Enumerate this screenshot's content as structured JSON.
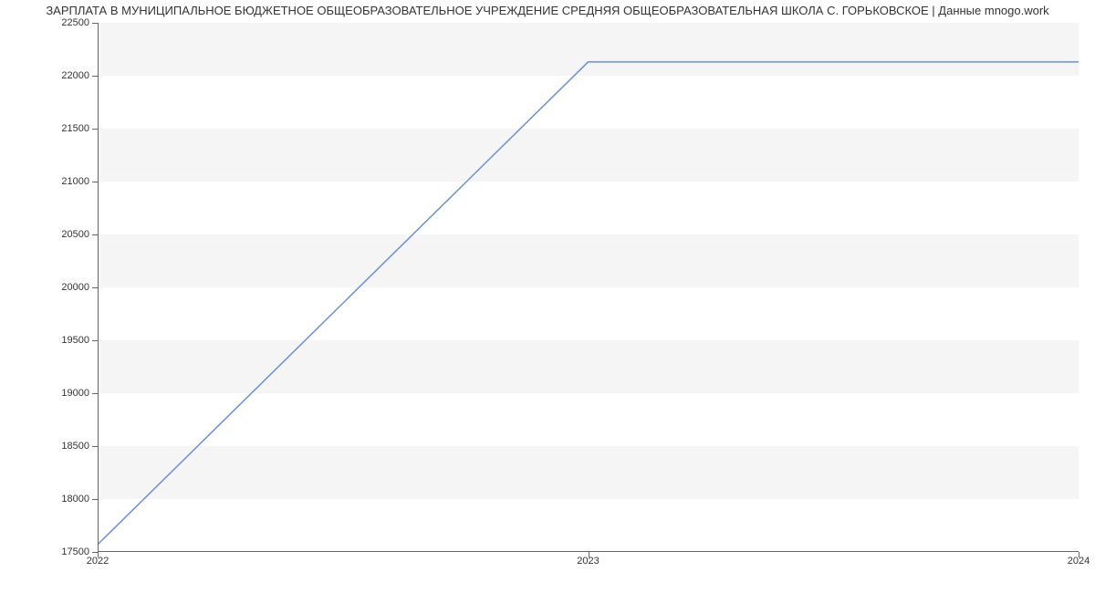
{
  "chart_data": {
    "type": "line",
    "title": "ЗАРПЛАТА В МУНИЦИПАЛЬНОЕ БЮДЖЕТНОЕ ОБЩЕОБРАЗОВАТЕЛЬНОЕ УЧРЕЖДЕНИЕ СРЕДНЯЯ ОБЩЕОБРАЗОВАТЕЛЬНАЯ ШКОЛА С. ГОРЬКОВСКОЕ | Данные mnogo.work",
    "xlabel": "",
    "ylabel": "",
    "ylim": [
      17500,
      22500
    ],
    "xlim": [
      2022,
      2024
    ],
    "x_ticks": [
      "2022",
      "2023",
      "2024"
    ],
    "y_ticks": [
      17500,
      18000,
      18500,
      19000,
      19500,
      20000,
      20500,
      21000,
      21500,
      22000,
      22500
    ],
    "x": [
      2022,
      2023,
      2024
    ],
    "values": [
      17570,
      22130,
      22130
    ],
    "line_color": "#6a8fd8"
  }
}
